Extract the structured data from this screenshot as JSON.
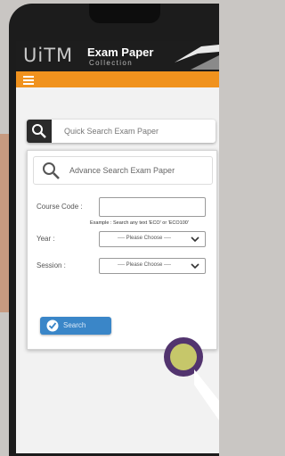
{
  "header": {
    "brand": "UiTM",
    "title": "Exam Paper",
    "subtitle": "Collection"
  },
  "quick_search": {
    "label": "Quick Search Exam Paper"
  },
  "advanced_search": {
    "label": "Advance Search Exam Paper",
    "course_code_label": "Course Code :",
    "course_code_value": "",
    "example": "Example : Search any text 'ECO' or 'ECO100'",
    "year_label": "Year :",
    "year_value": "---- Please Choose ----",
    "session_label": "Session :",
    "session_value": "---- Please Choose ----",
    "search_button": "Search"
  },
  "colors": {
    "header_bg": "#1d1d1d",
    "accent_orange": "#f0921e",
    "button_blue": "#3a86c8"
  }
}
